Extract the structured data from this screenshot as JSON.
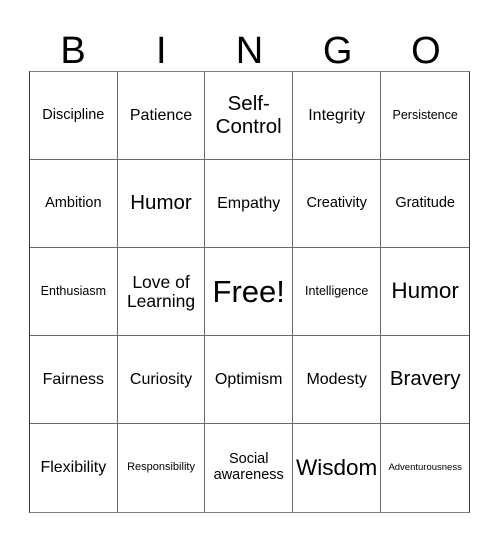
{
  "card": {
    "title_letters": [
      "B",
      "I",
      "N",
      "G",
      "O"
    ],
    "columns": 5,
    "rows": 5,
    "free_space_label": "Free!",
    "free_space_position": {
      "row": 3,
      "column": 3
    },
    "colors": {
      "background": "#ffffff",
      "text": "#000000",
      "grid_line": "#6a6a6a",
      "grid_outer": "#3a3a3a"
    },
    "cells": [
      {
        "text": "Discipline",
        "size": "m"
      },
      {
        "text": "Patience",
        "size": "ml"
      },
      {
        "text": "Self-\nControl",
        "size": "xl"
      },
      {
        "text": "Integrity",
        "size": "ml"
      },
      {
        "text": "Persistence",
        "size": "s"
      },
      {
        "text": "Ambition",
        "size": "m"
      },
      {
        "text": "Humor",
        "size": "xl"
      },
      {
        "text": "Empathy",
        "size": "ml"
      },
      {
        "text": "Creativity",
        "size": "m"
      },
      {
        "text": "Gratitude",
        "size": "m"
      },
      {
        "text": "Enthusiasm",
        "size": "s"
      },
      {
        "text": "Love of\nLearning",
        "size": "l"
      },
      {
        "text": "Free!",
        "size": "free"
      },
      {
        "text": "Intelligence",
        "size": "s"
      },
      {
        "text": "Humor",
        "size": "xxl"
      },
      {
        "text": "Fairness",
        "size": "ml"
      },
      {
        "text": "Curiosity",
        "size": "ml"
      },
      {
        "text": "Optimism",
        "size": "ml"
      },
      {
        "text": "Modesty",
        "size": "ml"
      },
      {
        "text": "Bravery",
        "size": "xl"
      },
      {
        "text": "Flexibility",
        "size": "ml"
      },
      {
        "text": "Responsibility",
        "size": "xs"
      },
      {
        "text": "Social\nawareness",
        "size": "m"
      },
      {
        "text": "Wisdom",
        "size": "xxl"
      },
      {
        "text": "Adventurousness",
        "size": "xxs"
      }
    ]
  }
}
